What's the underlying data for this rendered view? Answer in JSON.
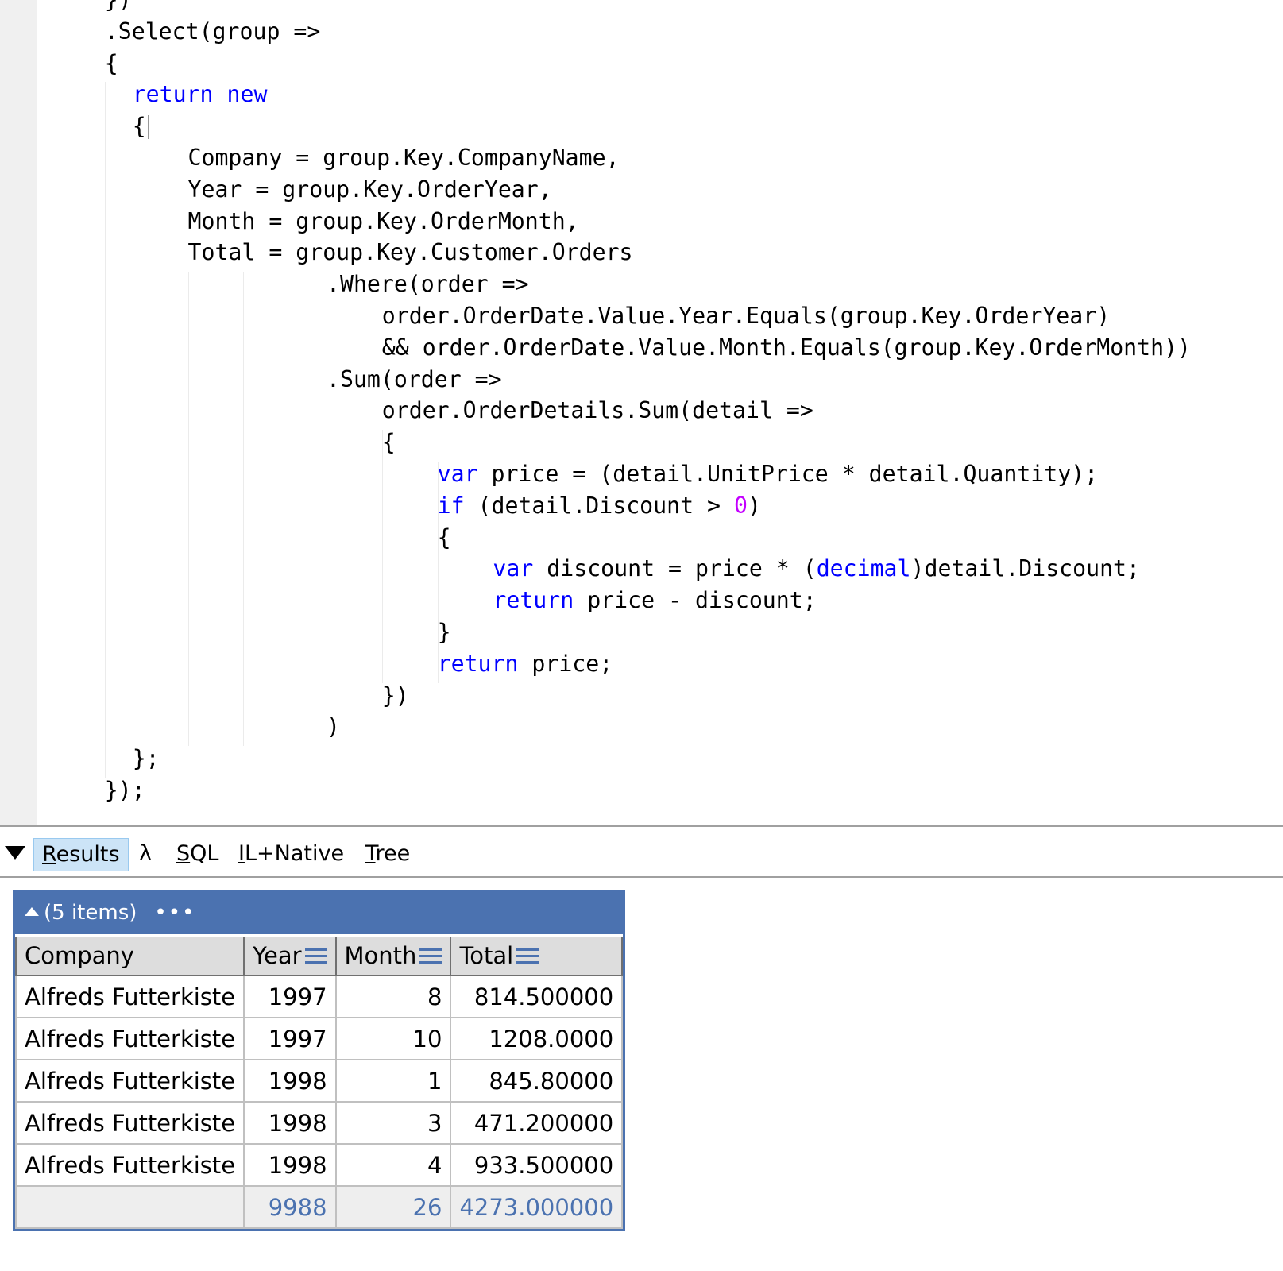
{
  "editor": {
    "lines": [
      {
        "indent": 4,
        "parts": [
          {
            "t": "})"
          }
        ]
      },
      {
        "indent": 4,
        "parts": [
          {
            "t": ".Select(group =>"
          }
        ]
      },
      {
        "indent": 4,
        "parts": [
          {
            "t": "{"
          }
        ]
      },
      {
        "indent": 6,
        "parts": [
          {
            "t": "return",
            "k": "kw"
          },
          {
            "t": " "
          },
          {
            "t": "new",
            "k": "kw"
          }
        ]
      },
      {
        "indent": 6,
        "parts": [
          {
            "t": "{"
          }
        ]
      },
      {
        "indent": 10,
        "parts": [
          {
            "t": "Company = group.Key.CompanyName,"
          }
        ]
      },
      {
        "indent": 10,
        "parts": [
          {
            "t": "Year = group.Key.OrderYear,"
          }
        ]
      },
      {
        "indent": 10,
        "parts": [
          {
            "t": "Month = group.Key.OrderMonth,"
          }
        ]
      },
      {
        "indent": 10,
        "parts": [
          {
            "t": "Total = group.Key.Customer.Orders"
          }
        ]
      },
      {
        "indent": 20,
        "parts": [
          {
            "t": ".Where(order =>"
          }
        ]
      },
      {
        "indent": 24,
        "parts": [
          {
            "t": "order.OrderDate.Value.Year.Equals(group.Key.OrderYear)"
          }
        ]
      },
      {
        "indent": 24,
        "parts": [
          {
            "t": "&& order.OrderDate.Value.Month.Equals(group.Key.OrderMonth))"
          }
        ]
      },
      {
        "indent": 20,
        "parts": [
          {
            "t": ".Sum(order =>"
          }
        ]
      },
      {
        "indent": 24,
        "parts": [
          {
            "t": "order.OrderDetails.Sum(detail =>"
          }
        ]
      },
      {
        "indent": 24,
        "parts": [
          {
            "t": "{"
          }
        ]
      },
      {
        "indent": 28,
        "parts": [
          {
            "t": "var",
            "k": "kw"
          },
          {
            "t": " price = (detail.UnitPrice * detail.Quantity);"
          }
        ]
      },
      {
        "indent": 28,
        "parts": [
          {
            "t": "if",
            "k": "kw"
          },
          {
            "t": " (detail.Discount > "
          },
          {
            "t": "0",
            "k": "num"
          },
          {
            "t": ")"
          }
        ]
      },
      {
        "indent": 28,
        "parts": [
          {
            "t": "{"
          }
        ]
      },
      {
        "indent": 32,
        "parts": [
          {
            "t": "var",
            "k": "kw"
          },
          {
            "t": " discount = price * ("
          },
          {
            "t": "decimal",
            "k": "kw"
          },
          {
            "t": ")detail.Discount;"
          }
        ]
      },
      {
        "indent": 32,
        "parts": [
          {
            "t": "return",
            "k": "kw"
          },
          {
            "t": " price - discount;"
          }
        ]
      },
      {
        "indent": 28,
        "parts": [
          {
            "t": "}"
          }
        ]
      },
      {
        "indent": 28,
        "parts": [
          {
            "t": "return",
            "k": "kw"
          },
          {
            "t": " price;"
          }
        ]
      },
      {
        "indent": 24,
        "parts": [
          {
            "t": "})"
          }
        ]
      },
      {
        "indent": 20,
        "parts": [
          {
            "t": ")"
          }
        ]
      },
      {
        "indent": 6,
        "parts": [
          {
            "t": "};"
          }
        ]
      },
      {
        "indent": 4,
        "parts": [
          {
            "t": "});"
          }
        ]
      }
    ]
  },
  "output_tabs": {
    "collapse_icon": "triangle-down-icon",
    "tabs": [
      {
        "id": "results",
        "pre": "",
        "u": "R",
        "post": "esults",
        "active": true
      },
      {
        "id": "lambda",
        "pre": "λ",
        "u": "",
        "post": "",
        "active": false
      },
      {
        "id": "sql",
        "pre": "",
        "u": "S",
        "post": "QL",
        "active": false
      },
      {
        "id": "il-native",
        "pre": "",
        "u": "I",
        "post": "L+Native",
        "active": false
      },
      {
        "id": "tree",
        "pre": "",
        "u": "T",
        "post": "ree",
        "active": false
      }
    ]
  },
  "results": {
    "summary": "(5 items)",
    "more_label": "•••",
    "columns": [
      {
        "label": "Company",
        "menu": false
      },
      {
        "label": "Year",
        "menu": true
      },
      {
        "label": "Month",
        "menu": true
      },
      {
        "label": "Total",
        "menu": true
      }
    ],
    "rows": [
      [
        "Alfreds Futterkiste",
        "1997",
        "8",
        "814.500000"
      ],
      [
        "Alfreds Futterkiste",
        "1997",
        "10",
        "1208.0000"
      ],
      [
        "Alfreds Futterkiste",
        "1998",
        "1",
        "845.80000"
      ],
      [
        "Alfreds Futterkiste",
        "1998",
        "3",
        "471.200000"
      ],
      [
        "Alfreds Futterkiste",
        "1998",
        "4",
        "933.500000"
      ]
    ],
    "totals": [
      "",
      "9988",
      "26",
      "4273.000000"
    ],
    "accent_color": "#4b72b0"
  }
}
